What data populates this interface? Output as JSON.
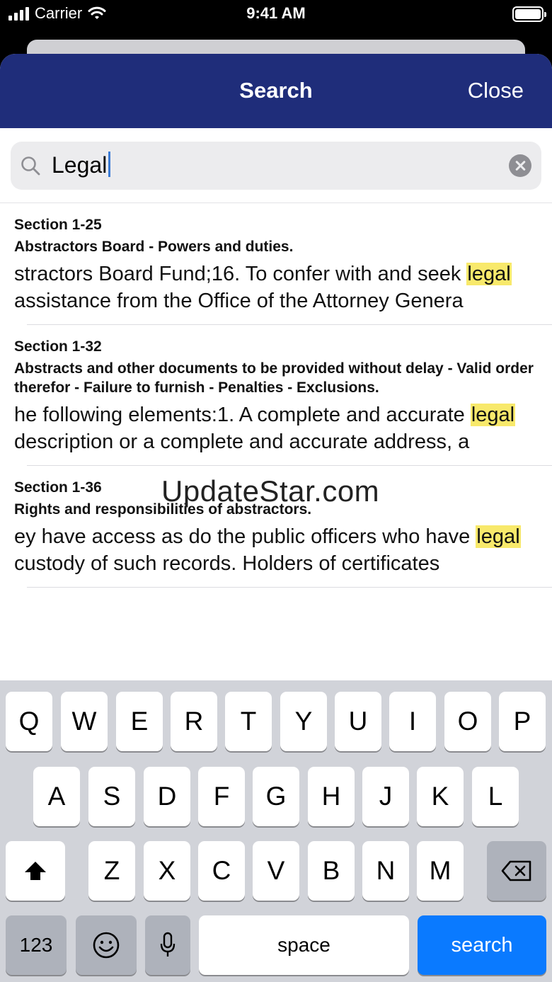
{
  "status_bar": {
    "carrier": "Carrier",
    "time": "9:41 AM"
  },
  "nav": {
    "title": "Search",
    "close_label": "Close"
  },
  "search": {
    "value": "Legal"
  },
  "results": [
    {
      "section": "Section 1-25",
      "title": "Abstractors Board - Powers and duties.",
      "snippet_before": "stractors Board Fund;16.  To confer with and seek ",
      "highlight": "legal",
      "snippet_after": " assistance from the Office of the Attorney Genera"
    },
    {
      "section": "Section 1-32",
      "title": "Abstracts and other documents to be provided without delay - Valid order therefor - Failure to furnish - Penalties - Exclusions.",
      "snippet_before": "he following elements:1.  A complete and accurate ",
      "highlight": "legal",
      "snippet_after": " description or a complete and accurate address, a"
    },
    {
      "section": "Section 1-36",
      "title": "Rights and responsibilities of abstractors.",
      "snippet_before": "ey have access as do the public officers who have ",
      "highlight": "legal",
      "snippet_after": " custody of such records. Holders of certificates"
    }
  ],
  "watermark": "UpdateStar.com",
  "keyboard": {
    "row1": [
      "Q",
      "W",
      "E",
      "R",
      "T",
      "Y",
      "U",
      "I",
      "O",
      "P"
    ],
    "row2": [
      "A",
      "S",
      "D",
      "F",
      "G",
      "H",
      "J",
      "K",
      "L"
    ],
    "row3": [
      "Z",
      "X",
      "C",
      "V",
      "B",
      "N",
      "M"
    ],
    "numbers_label": "123",
    "space_label": "space",
    "search_label": "search"
  },
  "icons": {
    "signal": "signal-bars-icon",
    "wifi": "wifi-icon",
    "battery": "battery-icon",
    "search": "magnifier-icon",
    "clear": "clear-x-circle-icon",
    "shift": "shift-arrow-icon",
    "delete": "backspace-icon",
    "emoji": "emoji-smiley-icon",
    "mic": "microphone-icon"
  },
  "colors": {
    "nav": "#1f2d7a",
    "highlight": "#f8e96b",
    "search_key": "#0a7aff"
  }
}
